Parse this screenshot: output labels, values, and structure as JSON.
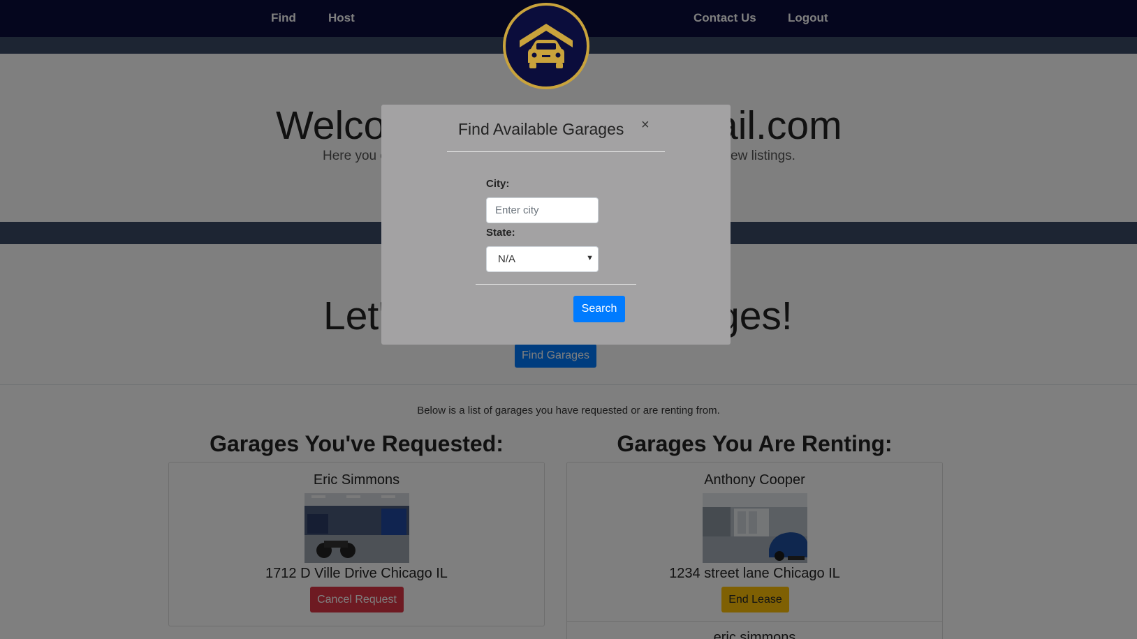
{
  "nav": {
    "find": "Find",
    "host": "Host",
    "contact": "Contact Us",
    "logout": "Logout"
  },
  "hero": {
    "welcome_left": "Welco",
    "welcome_right": "ail.com",
    "lead_left": "Here you c",
    "lead_right": "ew listings."
  },
  "find_section": {
    "title_left": "Let'",
    "title_right": "ges!",
    "button": "Find Garages"
  },
  "list_intro": "Below is a list of garages you have requested or are renting from.",
  "requested": {
    "title": "Garages You've Requested:",
    "items": [
      {
        "owner": "Eric Simmons",
        "address": "1712 D Ville Drive Chicago IL",
        "action": "Cancel Request"
      }
    ]
  },
  "renting": {
    "title": "Garages You Are Renting:",
    "items": [
      {
        "owner": "Anthony Cooper",
        "address": "1234 street lane Chicago IL",
        "action": "End Lease"
      },
      {
        "owner": "eric simmons"
      }
    ]
  },
  "modal": {
    "title": "Find Available Garages",
    "close": "×",
    "city_label": "City:",
    "city_placeholder": "Enter city",
    "state_label": "State:",
    "state_value": "N/A",
    "search": "Search"
  },
  "icons": {
    "logo": "garage-car-logo-icon",
    "caret": "chevron-down-icon"
  },
  "colors": {
    "nav_bg": "#0b0d3c",
    "band_bg": "#3a4a66",
    "logo_gold": "#c9a33c",
    "primary": "#007bff",
    "danger": "#dc3545",
    "warning": "#ffc107",
    "modal_bg": "#a3a2a3"
  }
}
